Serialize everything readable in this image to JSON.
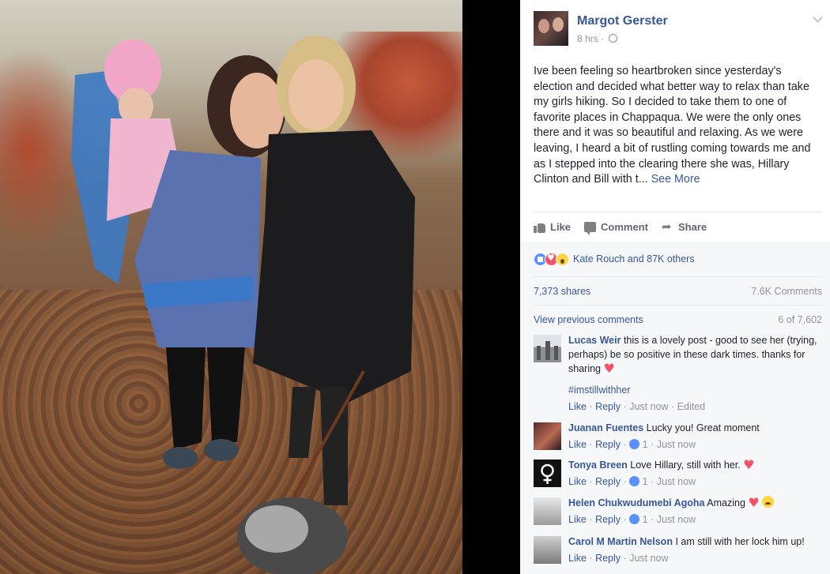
{
  "post": {
    "author": "Margot Gerster",
    "time": "8 hrs",
    "dot": "·",
    "text": "Ive been feeling so heartbroken since yesterday's election and decided what better way to relax than take my girls hiking. So I decided to take them to one of favorite places in Chappaqua. We were the only ones there and it was so beautiful and relaxing. As we were leaving, I heard a bit of rustling coming towards me and as I stepped into the clearing there she was, Hillary Clinton and Bill with t...",
    "see_more": "See More"
  },
  "actions": {
    "like": "Like",
    "comment": "Comment",
    "share": "Share"
  },
  "reactions": {
    "summary": "Kate Rouch and 87K others",
    "icons": [
      "like-icon",
      "love-icon",
      "wow-icon"
    ]
  },
  "stats": {
    "shares": "7,373 shares",
    "comments": "7.6K Comments"
  },
  "view_previous": {
    "label": "View previous comments",
    "count": "6 of 7,602"
  },
  "comments": [
    {
      "name": "Lucas Weir",
      "text": "this is a lovely post - good to see her (trying, perhaps) be so positive in these dark times. thanks for sharing",
      "hashtag": "#imstillwithher",
      "like": "Like",
      "reply": "Reply",
      "time": "Just now",
      "edited": "Edited"
    },
    {
      "name": "Juanan Fuentes",
      "text": "Lucky you! Great moment",
      "like": "Like",
      "reply": "Reply",
      "count": "1",
      "time": "Just now"
    },
    {
      "name": "Tonya Breen",
      "text": "Love Hillary, still with her.",
      "like": "Like",
      "reply": "Reply",
      "count": "1",
      "time": "Just now"
    },
    {
      "name": "Helen Chukwudumebi Agoha",
      "text": "Amazing",
      "like": "Like",
      "reply": "Reply",
      "count": "1",
      "time": "Just now"
    },
    {
      "name": "Carol M Martin Nelson",
      "text": "I am still with her lock him up!",
      "like": "Like",
      "reply": "Reply",
      "time": "Just now"
    }
  ],
  "sep": "·",
  "colors": {
    "link": "#365899",
    "meta": "#90949c",
    "text": "#1d2129",
    "heart": "#f25268"
  }
}
